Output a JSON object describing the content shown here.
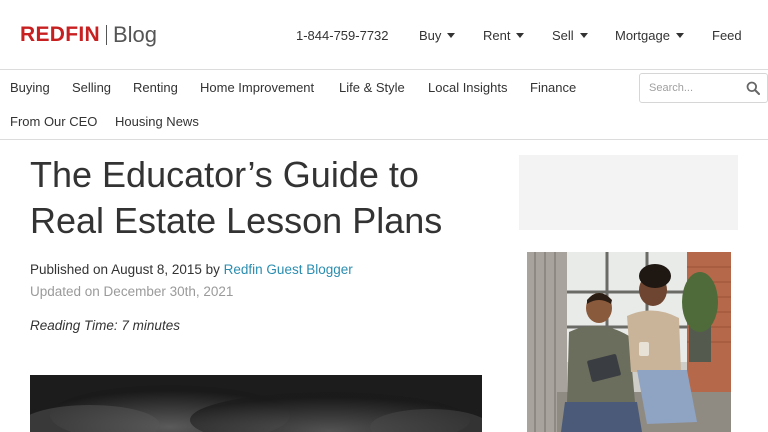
{
  "header": {
    "logo_brand": "REDFIN",
    "logo_section": "Blog",
    "phone": "1-844-759-7732",
    "nav": [
      {
        "label": "Buy"
      },
      {
        "label": "Rent"
      },
      {
        "label": "Sell"
      },
      {
        "label": "Mortgage"
      },
      {
        "label": "Feed"
      }
    ]
  },
  "categories": [
    "Buying",
    "Selling",
    "Renting",
    "Home Improvement",
    "Life & Style",
    "Local Insights",
    "Finance",
    "From Our CEO",
    "Housing News"
  ],
  "search": {
    "placeholder": "Search..."
  },
  "article": {
    "title": "The Educator’s Guide to Real Estate Lesson Plans",
    "published_prefix": "Published on August 8, 2015 by ",
    "author": "Redfin Guest Blogger",
    "updated": "Updated on December 30th, 2021",
    "reading_time": "Reading Time: 7 minutes"
  },
  "colors": {
    "brand": "#c82021",
    "link": "#2a8db0",
    "muted": "#9a9a9a"
  },
  "icons": {
    "search": "search-icon",
    "dropdown": "chevron-down-icon"
  }
}
